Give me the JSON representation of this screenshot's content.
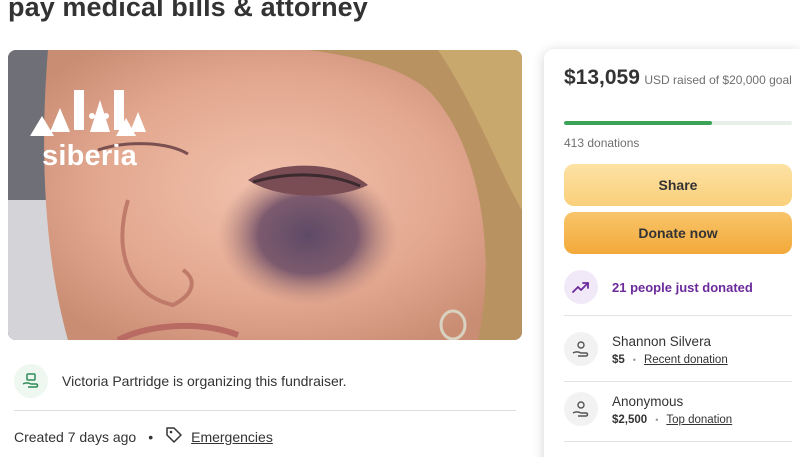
{
  "page": {
    "title": "pay medical bills & attorney"
  },
  "hero": {
    "logo_text": "siberia"
  },
  "organizer": {
    "text": "Victoria Partridge is organizing this fundraiser."
  },
  "meta": {
    "created": "Created 7 days ago",
    "separator": "•",
    "category": "Emergencies"
  },
  "donation_panel": {
    "amount_raised": "$13,059",
    "raised_suffix": "USD raised of $20,000 goal",
    "goal_progress_fraction": 0.65,
    "donations_count": "413 donations",
    "share_label": "Share",
    "donate_label": "Donate now",
    "trend_text": "21 people just donated",
    "donors": [
      {
        "name": "Shannon Silvera",
        "amount": "$5",
        "note": "Recent donation"
      },
      {
        "name": "Anonymous",
        "amount": "$2,500",
        "note": "Top donation"
      }
    ],
    "dot": "•"
  },
  "colors": {
    "progress": "#3aa357",
    "trend_text": "#6b2a9c",
    "donate_button": "#f3a93a",
    "share_button": "#f9cf7b"
  },
  "icons": [
    "gift-hands-icon",
    "tag-icon",
    "trend-up-icon"
  ]
}
